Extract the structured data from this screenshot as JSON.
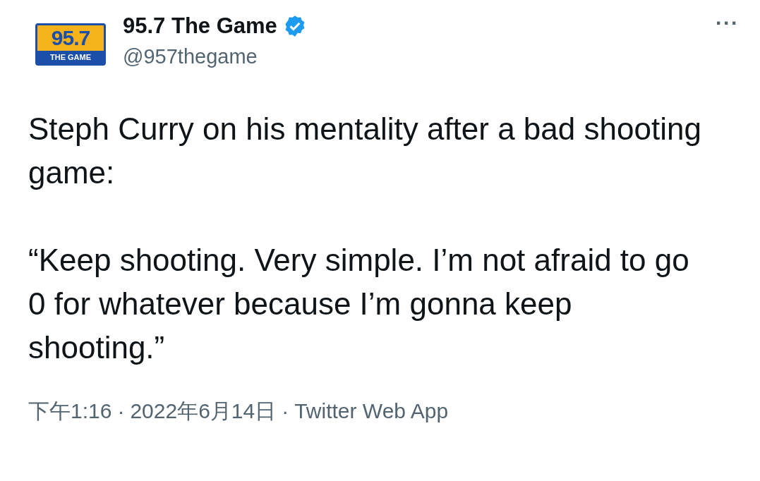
{
  "author": {
    "logo": {
      "number": "95.7",
      "tagline": "THE GAME"
    },
    "name": "95.7 The Game",
    "verified": true,
    "handle": "@957thegame"
  },
  "menu": {
    "label": "···"
  },
  "tweet": {
    "paragraphs": [
      "Steph Curry on his mentality after a bad shooting game:",
      "“Keep shooting. Very simple. I’m not afraid to go 0 for whatever because I’m gonna keep shooting.”"
    ]
  },
  "footer": {
    "time": "下午1:16",
    "date": "2022年6月14日",
    "source": "Twitter Web App",
    "separator": "·"
  }
}
